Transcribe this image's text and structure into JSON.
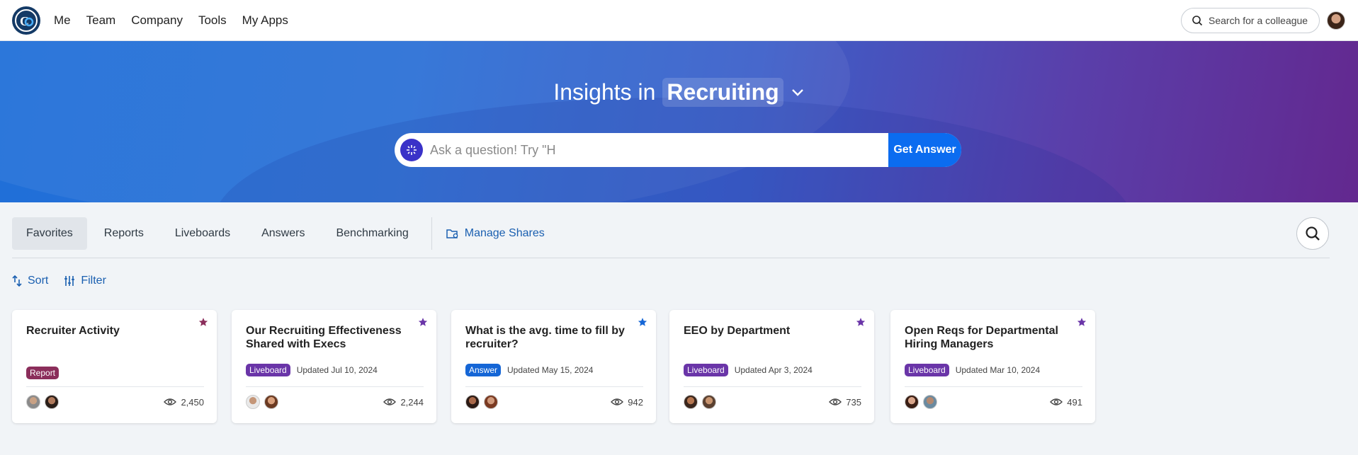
{
  "nav": {
    "items": [
      "Me",
      "Team",
      "Company",
      "Tools",
      "My Apps"
    ],
    "colleague_search_placeholder": "Search for a colleague"
  },
  "hero": {
    "title_prefix": "Insights in",
    "topic": "Recruiting",
    "ask_placeholder": "Ask a question! Try \"H",
    "get_answer_label": "Get Answer"
  },
  "tabs": {
    "items": [
      "Favorites",
      "Reports",
      "Liveboards",
      "Answers",
      "Benchmarking"
    ],
    "active": "Favorites",
    "manage_shares": "Manage Shares"
  },
  "toolbar": {
    "sort": "Sort",
    "filter": "Filter"
  },
  "colors": {
    "accent": "#0b6cf0",
    "report": "#8b2e5b",
    "liveboard": "#6a35a8",
    "answer": "#1566d6"
  },
  "cards": [
    {
      "title": "Recruiter Activity",
      "badge": "Report",
      "updated": "",
      "views": "2,450",
      "star_color": "#8b2e5b"
    },
    {
      "title": "Our Recruiting Effectiveness Shared with Execs",
      "badge": "Liveboard",
      "updated": "Updated Jul 10, 2024",
      "views": "2,244",
      "star_color": "#6a35a8"
    },
    {
      "title": "What is the avg. time to fill by recruiter?",
      "badge": "Answer",
      "updated": "Updated May 15, 2024",
      "views": "942",
      "star_color": "#1566d6"
    },
    {
      "title": "EEO by Department",
      "badge": "Liveboard",
      "updated": "Updated Apr 3, 2024",
      "views": "735",
      "star_color": "#6a35a8"
    },
    {
      "title": "Open Reqs for Departmental Hiring Managers",
      "badge": "Liveboard",
      "updated": "Updated Mar 10, 2024",
      "views": "491",
      "star_color": "#6a35a8"
    }
  ]
}
